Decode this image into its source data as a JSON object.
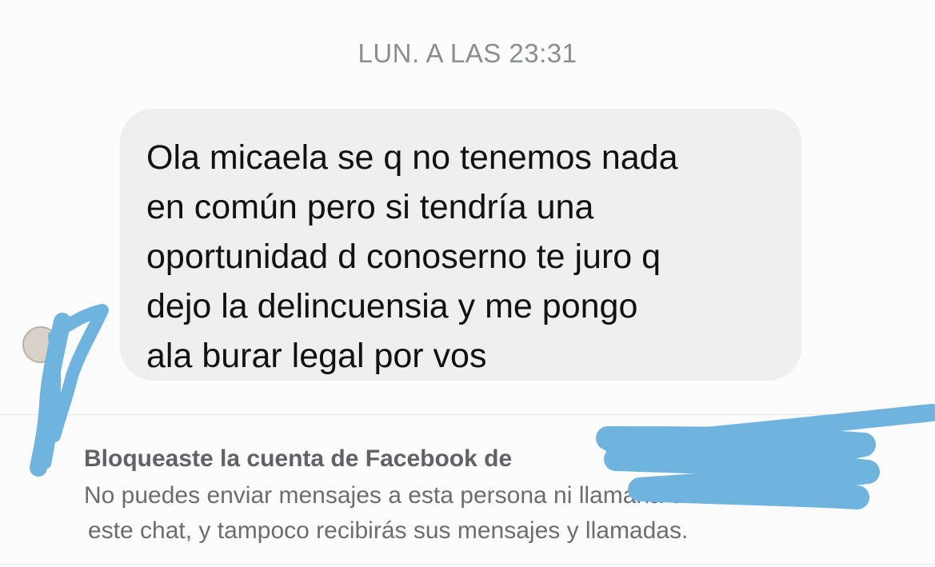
{
  "chat": {
    "timestamp": "LUN. A LAS 23:31",
    "message": {
      "lines": [
        "Ola micaela se q no tenemos nada",
        "en común pero si tendría una",
        "oportunidad d conoserno te juro q",
        "dejo la delincuensia y me pongo",
        "ala burar legal por vos"
      ]
    }
  },
  "block_notice": {
    "title": "Bloqueaste la cuenta de Facebook de",
    "description_lines": [
      "No puedes enviar mensajes a esta persona ni llamarla en",
      "este chat, y tampoco recibirás sus mensajes y llamadas."
    ]
  },
  "colors": {
    "bubble": "#efefef",
    "timestamp": "#8a8d91",
    "redaction_scribble": "#6fb3df"
  },
  "icons": {
    "avatar": "contact-avatar"
  }
}
